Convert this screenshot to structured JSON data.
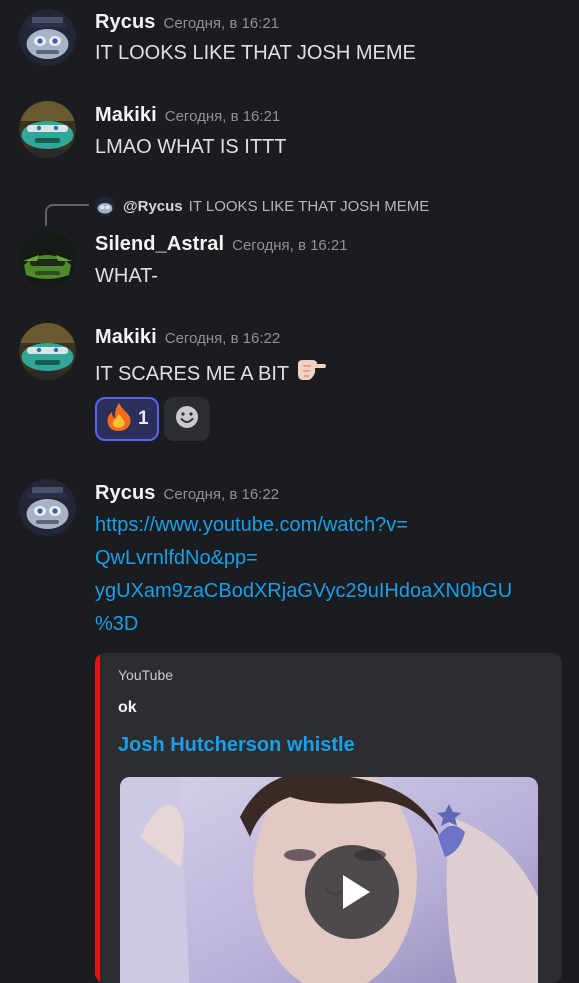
{
  "messages": [
    {
      "username": "Rycus",
      "timestamp": "Сегодня, в 16:21",
      "text": "IT LOOKS LIKE THAT JOSH MEME"
    },
    {
      "username": "Makiki",
      "timestamp": "Сегодня, в 16:21",
      "text": "LMAO WHAT IS ITTT"
    },
    {
      "reply": {
        "username": "@Rycus",
        "text": "IT LOOKS LIKE THAT JOSH MEME"
      },
      "username": "Silend_Astral",
      "timestamp": "Сегодня, в 16:21",
      "text": "WHAT-"
    },
    {
      "username": "Makiki",
      "timestamp": "Сегодня, в 16:22",
      "text": "IT SCARES ME A BIT",
      "reactions": [
        {
          "emoji": "fire",
          "count": "1"
        }
      ]
    },
    {
      "username": "Rycus",
      "timestamp": "Сегодня, в 16:22",
      "link_lines": [
        "https://www.youtube.com/watch?v=",
        "QwLvrnlfdNo&pp=",
        "ygUXam9zaCBodXRjaGVyc29uIHdoaXN0bGU",
        "%3D"
      ],
      "embed": {
        "provider": "YouTube",
        "author": "ok",
        "title": "Josh Hutcherson whistle"
      }
    }
  ],
  "colors": {
    "background": "#1b1c20",
    "link": "#1a9fe8",
    "youtube_red": "#e31414",
    "reaction_active": "#5865f2"
  },
  "icons": {
    "reaction_emoji": "fire-icon",
    "add_reaction": "smile-icon",
    "pointing": "pointing-hand-icon",
    "play": "play-icon"
  }
}
